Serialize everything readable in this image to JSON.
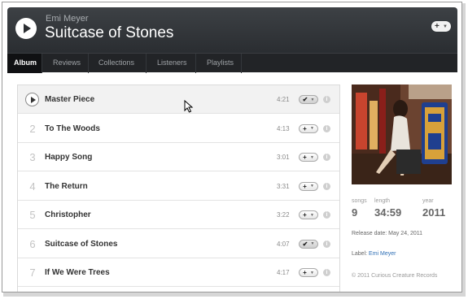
{
  "header": {
    "artist": "Emi Meyer",
    "album_title": "Suitcase of Stones",
    "play_icon": "play-icon",
    "add_icon": "plus-icon"
  },
  "tabs": [
    {
      "label": "Album",
      "active": true
    },
    {
      "label": "Reviews",
      "active": false
    },
    {
      "label": "Collections",
      "active": false
    },
    {
      "label": "Listeners",
      "active": false
    },
    {
      "label": "Playlists",
      "active": false
    }
  ],
  "tracks": [
    {
      "number": "1",
      "title": "Master Piece",
      "length": "4:21",
      "in_collection": true,
      "playing_row": true
    },
    {
      "number": "2",
      "title": "To The Woods",
      "length": "4:13",
      "in_collection": false
    },
    {
      "number": "3",
      "title": "Happy Song",
      "length": "3:01",
      "in_collection": false
    },
    {
      "number": "4",
      "title": "The Return",
      "length": "3:31",
      "in_collection": false
    },
    {
      "number": "5",
      "title": "Christopher",
      "length": "3:22",
      "in_collection": false
    },
    {
      "number": "6",
      "title": "Suitcase of Stones",
      "length": "4:07",
      "in_collection": true
    },
    {
      "number": "7",
      "title": "If We Were Trees",
      "length": "4:17",
      "in_collection": false
    }
  ],
  "sidebar": {
    "stats": {
      "songs_label": "songs",
      "songs_value": "9",
      "length_label": "length",
      "length_value": "34:59",
      "year_label": "year",
      "year_value": "2011"
    },
    "release_date": "Release date: May 24, 2011",
    "label_prefix": "Label:",
    "label_name": "Emi Meyer",
    "copyright": "© 2011 Curious Creature Records"
  },
  "colors": {
    "header_bg": "#2f3236",
    "tab_bg": "#222427",
    "link": "#2f6fb5"
  }
}
